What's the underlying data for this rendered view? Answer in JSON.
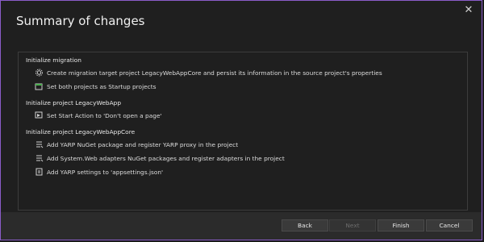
{
  "dialog": {
    "title": "Summary of changes",
    "close_label": "✕"
  },
  "sections": [
    {
      "header": "Initialize migration",
      "items": [
        {
          "icon": "gear-icon",
          "text": "Create migration target project LegacyWebAppCore and persist its information in the source project's properties"
        },
        {
          "icon": "startup-projects-icon",
          "text": "Set both projects as Startup projects"
        }
      ]
    },
    {
      "header": "Initialize project LegacyWebApp",
      "items": [
        {
          "icon": "start-action-icon",
          "text": "Set Start Action to 'Don't open a page'"
        }
      ]
    },
    {
      "header": "Initialize project LegacyWebAppCore",
      "items": [
        {
          "icon": "package-list-icon",
          "text": "Add YARP NuGet package and register YARP proxy in the project"
        },
        {
          "icon": "package-list-icon",
          "text": "Add System.Web adapters NuGet packages and register adapters in the project"
        },
        {
          "icon": "settings-file-icon",
          "text": "Add YARP settings to 'appsettings.json'"
        }
      ]
    }
  ],
  "footer": {
    "back": "Back",
    "next": "Next",
    "finish": "Finish",
    "cancel": "Cancel"
  }
}
